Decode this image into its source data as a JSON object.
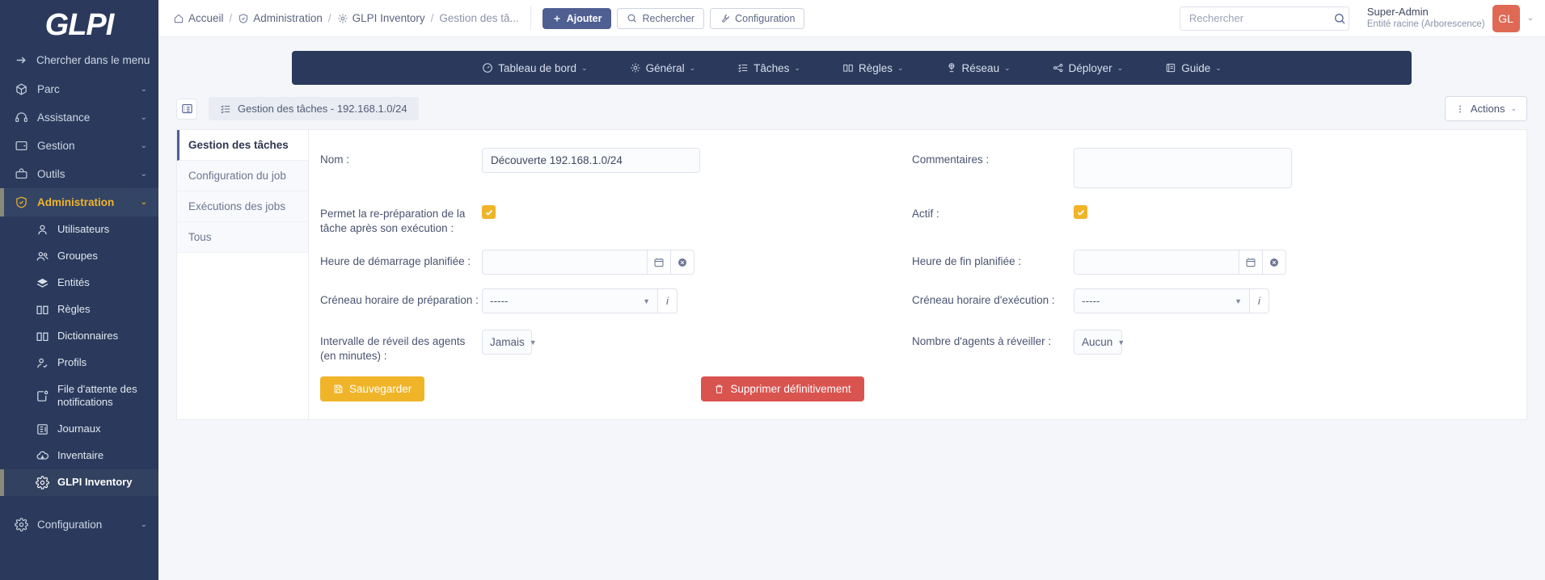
{
  "brand": {
    "logo_text": "GLPI",
    "sidebar_bg": "#2b3a5c",
    "accent": "#f0b429",
    "primary": "#4f5f92",
    "danger": "#d9534f"
  },
  "sidebar": {
    "search_label": "Chercher dans le menu",
    "items": [
      {
        "label": "Parc",
        "icon": "box-icon"
      },
      {
        "label": "Assistance",
        "icon": "headset-icon"
      },
      {
        "label": "Gestion",
        "icon": "wallet-icon"
      },
      {
        "label": "Outils",
        "icon": "briefcase-icon"
      },
      {
        "label": "Administration",
        "icon": "shield-icon",
        "active": true
      }
    ],
    "sub_items": [
      {
        "label": "Utilisateurs",
        "icon": "user-icon"
      },
      {
        "label": "Groupes",
        "icon": "users-icon"
      },
      {
        "label": "Entités",
        "icon": "layers-icon"
      },
      {
        "label": "Règles",
        "icon": "book-icon"
      },
      {
        "label": "Dictionnaires",
        "icon": "book-icon"
      },
      {
        "label": "Profils",
        "icon": "user-check-icon"
      },
      {
        "label": "File d'attente des notifications",
        "icon": "notification-icon"
      },
      {
        "label": "Journaux",
        "icon": "journal-icon"
      },
      {
        "label": "Inventaire",
        "icon": "cloud-download-icon"
      },
      {
        "label": "GLPI Inventory",
        "icon": "gear-icon",
        "selected": true
      }
    ],
    "footer_item": {
      "label": "Configuration",
      "icon": "gear-icon"
    }
  },
  "header": {
    "breadcrumb": [
      {
        "label": "Accueil",
        "icon": "home-icon"
      },
      {
        "label": "Administration",
        "icon": "shield-icon"
      },
      {
        "label": "GLPI Inventory",
        "icon": "gear-icon"
      },
      {
        "label": "Gestion des tâ...",
        "icon": ""
      }
    ],
    "buttons": [
      {
        "label": "Ajouter",
        "icon": "plus-icon",
        "style": "primary"
      },
      {
        "label": "Rechercher",
        "icon": "search-icon",
        "style": "outline"
      },
      {
        "label": "Configuration",
        "icon": "wrench-icon",
        "style": "outline"
      }
    ],
    "search": {
      "placeholder": "Rechercher",
      "value": ""
    },
    "user": {
      "name": "Super-Admin",
      "entity": "Entité racine (Arborescence)",
      "initials": "GL"
    }
  },
  "inventory_nav": [
    {
      "label": "Tableau de bord",
      "icon": "dashboard-icon"
    },
    {
      "label": "Général",
      "icon": "gear-icon"
    },
    {
      "label": "Tâches",
      "icon": "tasks-icon"
    },
    {
      "label": "Règles",
      "icon": "book-icon"
    },
    {
      "label": "Réseau",
      "icon": "network-icon"
    },
    {
      "label": "Déployer",
      "icon": "deploy-icon"
    },
    {
      "label": "Guide",
      "icon": "guide-icon"
    }
  ],
  "tabstrip": {
    "toggle_icon": "list-panel-icon",
    "current_tab": "Gestion des tâches - 192.168.1.0/24",
    "current_tab_icon": "tasks-icon",
    "actions_label": "Actions",
    "actions_icon": "dots-vertical-icon"
  },
  "vtabs": [
    {
      "label": "Gestion des tâches",
      "active": true
    },
    {
      "label": "Configuration du job",
      "active": false
    },
    {
      "label": "Exécutions des jobs",
      "active": false
    },
    {
      "label": "Tous",
      "active": false
    }
  ],
  "form": {
    "name_label": "Nom :",
    "name_value": "Découverte 192.168.1.0/24",
    "comments_label": "Commentaires :",
    "comments_value": "",
    "reprepare_label": "Permet la re-préparation de la tâche après son exécution :",
    "reprepare_checked": true,
    "active_label": "Actif :",
    "active_checked": true,
    "start_time_label": "Heure de démarrage planifiée :",
    "start_time_value": "",
    "end_time_label": "Heure de fin planifiée :",
    "end_time_value": "",
    "prep_slot_label": "Créneau horaire de préparation :",
    "prep_slot_value": "-----",
    "exec_slot_label": "Créneau horaire d'exécution :",
    "exec_slot_value": "-----",
    "wakeup_interval_label": "Intervalle de réveil des agents (en minutes) :",
    "wakeup_interval_value": "Jamais",
    "agents_count_label": "Nombre d'agents à réveiller :",
    "agents_count_value": "Aucun",
    "info_glyph": "i",
    "calendar_icon": "calendar-icon",
    "clear_icon": "clear-circle-icon",
    "save_label": "Sauvegarder",
    "save_icon": "floppy-icon",
    "delete_label": "Supprimer définitivement",
    "delete_icon": "trash-icon"
  }
}
